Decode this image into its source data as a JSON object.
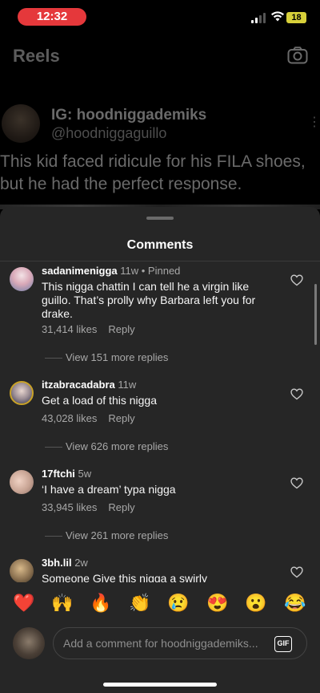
{
  "status_bar": {
    "time": "12:32",
    "battery": "18"
  },
  "header": {
    "title": "Reels"
  },
  "post": {
    "handle": "IG: hoodniggademiks",
    "subhandle": "@hoodniggaguillo",
    "caption": "This kid faced ridicule for his FILA shoes, but he had the perfect response."
  },
  "comments_sheet": {
    "title": "Comments",
    "comments": [
      {
        "username": "sadanimenigga",
        "meta": "11w • Pinned",
        "text": "This nigga chattin I can tell he a virgin like guillo. That’s prolly why Barbara left you for drake.",
        "likes": "31,414 likes",
        "reply": "Reply",
        "more_replies": "View 151 more replies"
      },
      {
        "username": "itzabracadabra",
        "meta": "11w",
        "text": "Get a load of this nigga",
        "likes": "43,028 likes",
        "reply": "Reply",
        "more_replies": "View 626 more replies"
      },
      {
        "username": "17ftchi",
        "meta": "5w",
        "text": "‘I have a dream’ typa nigga",
        "likes": "33,945 likes",
        "reply": "Reply",
        "more_replies": "View 261 more replies"
      },
      {
        "username": "3bh.lil",
        "meta": "2w",
        "text": "Someone Give this nigga a swirly"
      }
    ],
    "emojis": [
      "❤️",
      "🙌",
      "🔥",
      "👏",
      "😢",
      "😍",
      "😮",
      "😂"
    ],
    "input": {
      "placeholder": "Add a comment for hoodniggademiks...",
      "gif_label": "GIF"
    }
  }
}
